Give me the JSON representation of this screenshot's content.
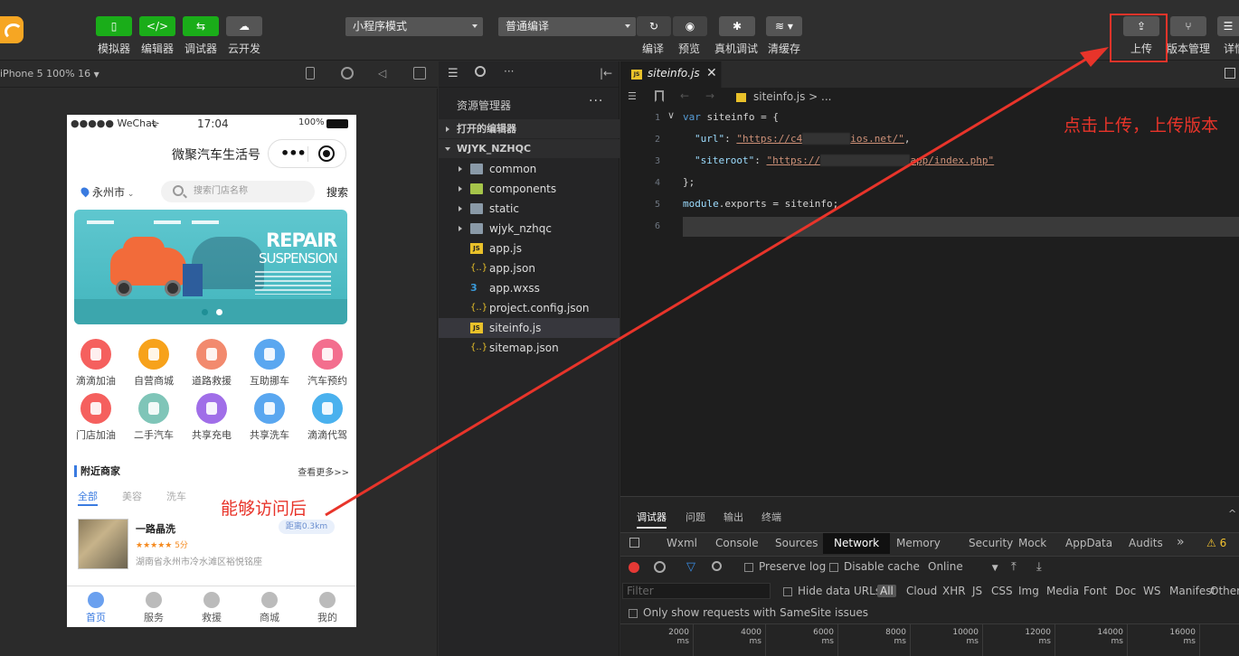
{
  "toolbar": {
    "buttons": [
      {
        "label": "模拟器",
        "icon": "phone-icon"
      },
      {
        "label": "编辑器",
        "icon": "code-icon"
      },
      {
        "label": "调试器",
        "icon": "debug-icon"
      },
      {
        "label": "云开发",
        "icon": "cloud-icon"
      }
    ],
    "mode_select": "小程序模式",
    "compile_select": "普通编译",
    "actions": [
      {
        "label": "编译",
        "icon": "refresh-icon"
      },
      {
        "label": "预览",
        "icon": "eye-icon"
      },
      {
        "label": "真机调试",
        "icon": "bug-icon"
      },
      {
        "label": "清缓存",
        "icon": "layers-icon"
      }
    ],
    "right": [
      {
        "label": "上传",
        "icon": "upload-icon"
      },
      {
        "label": "版本管理",
        "icon": "branch-icon"
      },
      {
        "label": "详情",
        "icon": "menu-icon"
      }
    ]
  },
  "simulator": {
    "device": "iPhone 5 100% 16",
    "status": {
      "carrier": "●●●●● WeChat",
      "time": "17:04",
      "battery": "100%"
    },
    "title": "微聚汽车生活号",
    "city": "永州市",
    "search_placeholder": "搜索门店名称",
    "search_button": "搜索",
    "banner": {
      "line1": "REPAIR",
      "line2": "SUSPENSION"
    },
    "services": [
      {
        "label": "滴滴加油",
        "color": "#f5605e"
      },
      {
        "label": "自营商城",
        "color": "#f7a21b"
      },
      {
        "label": "道路救援",
        "color": "#f28a6e"
      },
      {
        "label": "互助挪车",
        "color": "#5aa7f0"
      },
      {
        "label": "汽车预约",
        "color": "#f36e8e"
      },
      {
        "label": "门店加油",
        "color": "#f5605e"
      },
      {
        "label": "二手汽车",
        "color": "#7fc5b8"
      },
      {
        "label": "共享充电",
        "color": "#a06ee8"
      },
      {
        "label": "共享洗车",
        "color": "#5aa7f0"
      },
      {
        "label": "滴滴代驾",
        "color": "#4ab1ee"
      }
    ],
    "nearby_title": "附近商家",
    "nearby_more": "查看更多>>",
    "tabs": [
      "全部",
      "美容",
      "洗车"
    ],
    "shop": {
      "name": "一路晶洗",
      "distance": "距离0.3km",
      "stars": "★★★★★ 5分",
      "rating": 5,
      "address": "湖南省永州市冷水滩区裕悦铭座"
    },
    "tabbar": [
      "首页",
      "服务",
      "救援",
      "商城",
      "我的"
    ]
  },
  "annotation_left": "能够访问后",
  "annotation_right": "点击上传，上传版本",
  "explorer": {
    "title": "资源管理器",
    "more": "···",
    "open_editors": "打开的编辑器",
    "project": "WJYK_NZHQC",
    "items": [
      {
        "name": "common",
        "type": "folder"
      },
      {
        "name": "components",
        "type": "folder-g"
      },
      {
        "name": "static",
        "type": "folder"
      },
      {
        "name": "wjyk_nzhqc",
        "type": "folder"
      },
      {
        "name": "app.js",
        "type": "js"
      },
      {
        "name": "app.json",
        "type": "json"
      },
      {
        "name": "app.wxss",
        "type": "wxss"
      },
      {
        "name": "project.config.json",
        "type": "json"
      },
      {
        "name": "siteinfo.js",
        "type": "js",
        "selected": true
      },
      {
        "name": "sitemap.json",
        "type": "json"
      }
    ]
  },
  "editor": {
    "tab": "siteinfo.js",
    "tab_close": "✕",
    "breadcrumb": "siteinfo.js > ...",
    "lines": [
      "1",
      "2",
      "3",
      "4",
      "5",
      "6"
    ],
    "code": {
      "l1_kw": "var",
      "l1_rest": " siteinfo = {",
      "l2_key": "\"url\"",
      "l2_colon": ": ",
      "l2_url": "\"https://c4",
      "l2_url_end": "ios.net/\"",
      "l2_end": ",",
      "l3_key": "\"siteroot\"",
      "l3_colon": ": ",
      "l3_url": "\"https://",
      "l3_url_end": "app/index.php\"",
      "l4": "};",
      "l5_id": "module",
      "l5_rest": ".exports = siteinfo;"
    }
  },
  "devtools": {
    "panel_tabs": [
      "调试器",
      "问题",
      "输出",
      "终端"
    ],
    "tabs": [
      "Wxml",
      "Console",
      "Sources",
      "Network",
      "Memory",
      "Security",
      "Mock",
      "AppData",
      "Audits"
    ],
    "more": "»",
    "warnings": "⚠ 6",
    "preserve_log": "Preserve log",
    "disable_cache": "Disable cache",
    "online": "Online",
    "filter_placeholder": "Filter",
    "hide_data_urls": "Hide data URLs",
    "all": "All",
    "types": [
      "Cloud",
      "XHR",
      "JS",
      "CSS",
      "Img",
      "Media",
      "Font",
      "Doc",
      "WS",
      "Manifest",
      "Other"
    ],
    "samesite": "Only show requests with SameSite issues",
    "ticks": [
      "2000 ms",
      "4000 ms",
      "6000 ms",
      "8000 ms",
      "10000 ms",
      "12000 ms",
      "14000 ms",
      "16000 ms"
    ]
  }
}
